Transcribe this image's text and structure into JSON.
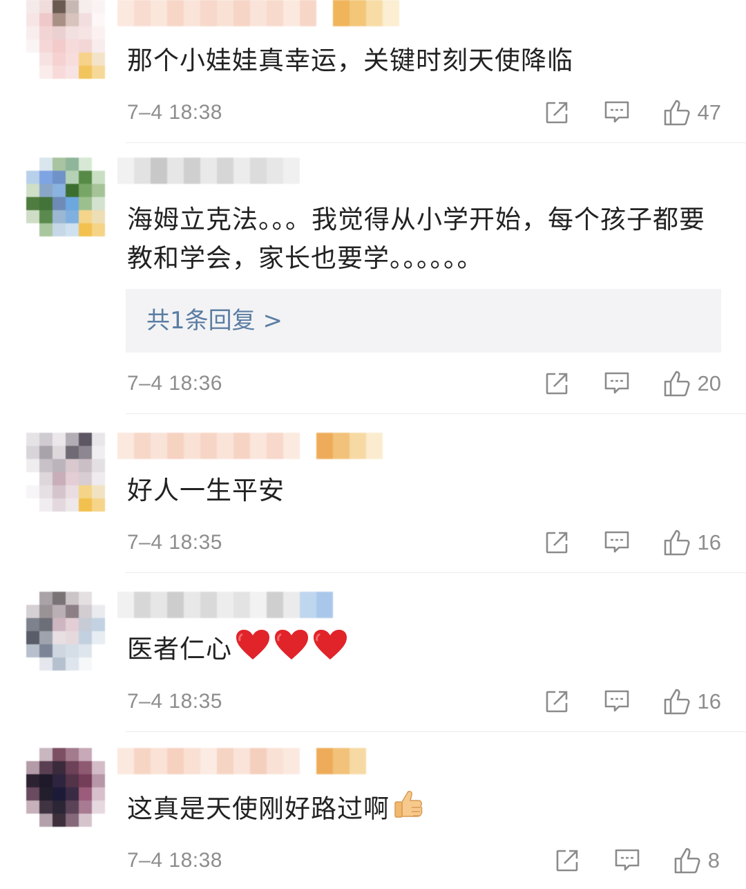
{
  "comments": [
    {
      "text": "那个小娃娃真幸运，关键时刻天使降临",
      "time": "7–4 18:38",
      "likes": "47"
    },
    {
      "text": "海姆立克法。。。我觉得从小学开始，每个孩子都要教和学会，家长也要学。。。。。。",
      "reply_label": "共1条回复 >",
      "time": "7–4 18:36",
      "likes": "20"
    },
    {
      "text": "好人一生平安",
      "time": "7–4 18:35",
      "likes": "16"
    },
    {
      "text": "医者仁心",
      "emoji": "heart",
      "emoji_count": 3,
      "time": "7–4 18:35",
      "likes": "16"
    },
    {
      "text": "这真是天使刚好路过啊",
      "emoji": "thumbs-up",
      "time": "7–4 18:38",
      "likes": "8"
    }
  ],
  "icons": [
    "share-icon",
    "comment-icon",
    "like-icon",
    "heart-emoji-icon",
    "thumbs-up-emoji-icon"
  ],
  "colors": {
    "text": "#222222",
    "meta": "#8d8d8d",
    "reply_link": "#5b7da3",
    "reply_bg": "#f3f3f5",
    "heart": "#e0242a"
  }
}
